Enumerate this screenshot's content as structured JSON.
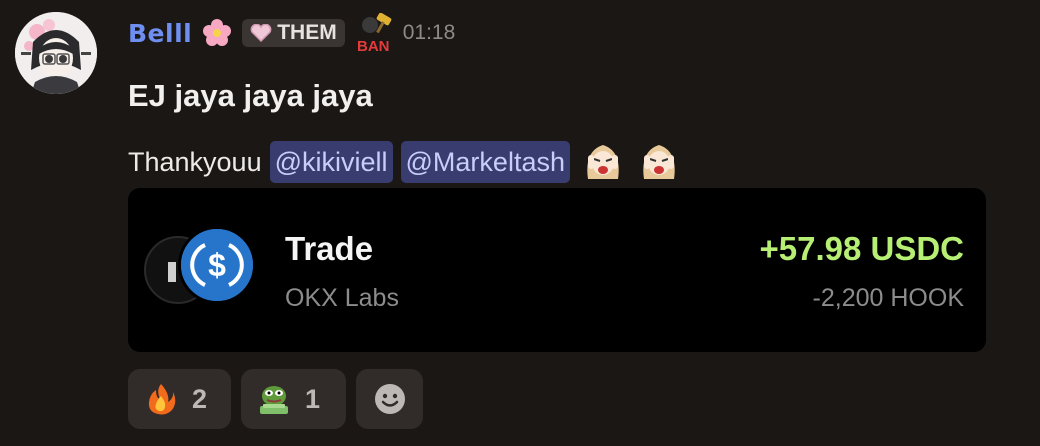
{
  "message": {
    "author": "Belll",
    "role_tag": "THEM",
    "timestamp": "01:18",
    "title": "EJ jaya jaya jaya",
    "body_text": "Thankyouu",
    "mentions": [
      "@kikiviell",
      "@Markeltash"
    ],
    "badge_text": "BAN"
  },
  "trade_card": {
    "title": "Trade",
    "subtitle": "OKX Labs",
    "received": "+57.98 USDC",
    "sent": "-2,200 HOOK",
    "coin_icon": "usdc-coin-icon"
  },
  "reactions": [
    {
      "emoji": "fire",
      "count": "2"
    },
    {
      "emoji": "pepe-money",
      "count": "1"
    }
  ],
  "colors": {
    "background": "#1b1715",
    "username": "#6e8ff0",
    "mention_bg": "#383c6e",
    "received": "#b7ee74",
    "usdc": "#2775ca"
  }
}
